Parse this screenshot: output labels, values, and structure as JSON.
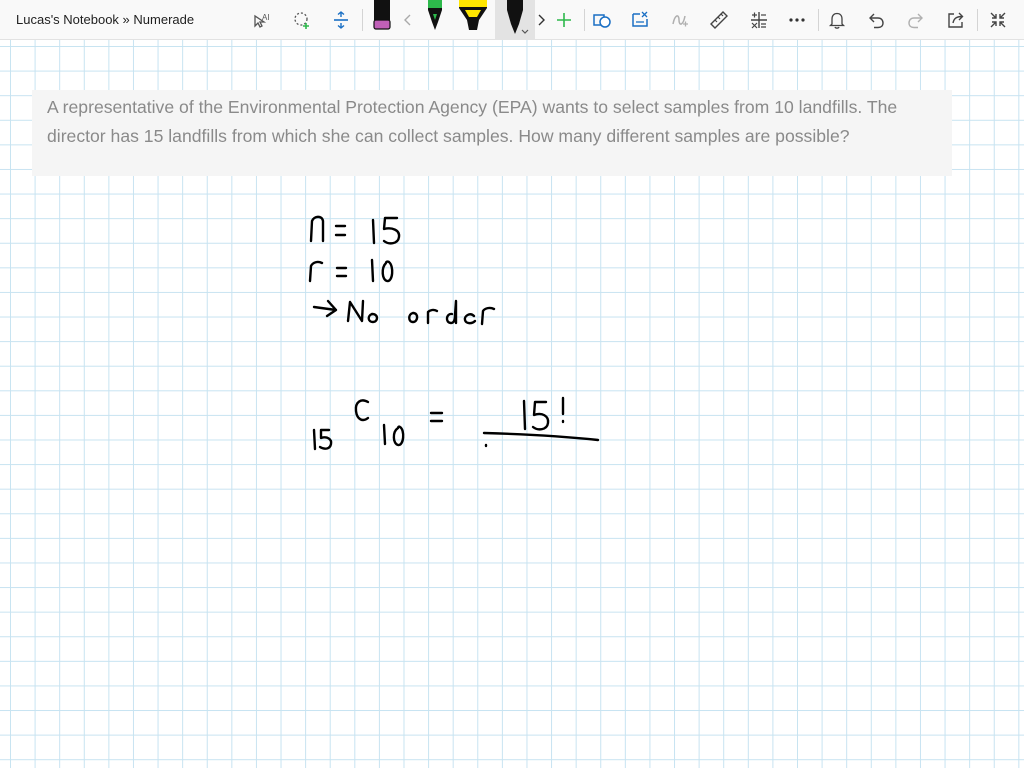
{
  "window": {
    "title": "Lucas's Notebook » Numerade"
  },
  "toolbar": {
    "tools": [
      {
        "name": "select-text-tool",
        "icon": "text-select-icon"
      },
      {
        "name": "lasso-select-tool",
        "icon": "lasso-add-icon"
      },
      {
        "name": "add-space-tool",
        "icon": "add-space-icon"
      },
      {
        "name": "eraser-tool",
        "icon": "eraser-icon",
        "color": "#c060b8"
      },
      {
        "name": "scroll-pens-left",
        "icon": "chevron-left-icon"
      },
      {
        "name": "pen-green",
        "icon": "pen-icon",
        "color": "#2db84b"
      },
      {
        "name": "highlighter-yellow",
        "icon": "highlighter-icon",
        "color": "#ffe600"
      },
      {
        "name": "pen-black",
        "icon": "pen-icon",
        "color": "#111111"
      },
      {
        "name": "scroll-pens-right",
        "icon": "chevron-right-icon"
      },
      {
        "name": "add-pen",
        "icon": "plus-icon",
        "color": "#2db84b"
      },
      {
        "name": "ink-to-shape",
        "icon": "shape-icon"
      },
      {
        "name": "ink-to-text",
        "icon": "ink-to-text-icon"
      },
      {
        "name": "ink-to-math",
        "icon": "ink-math-icon"
      },
      {
        "name": "ruler",
        "icon": "ruler-icon"
      },
      {
        "name": "math-tool",
        "icon": "math-icon"
      },
      {
        "name": "more",
        "icon": "more-icon"
      },
      {
        "name": "notifications",
        "icon": "bell-icon"
      },
      {
        "name": "undo",
        "icon": "undo-icon"
      },
      {
        "name": "redo",
        "icon": "redo-icon"
      },
      {
        "name": "share",
        "icon": "share-icon"
      },
      {
        "name": "exit-full-screen",
        "icon": "collapse-icon"
      }
    ]
  },
  "problem": {
    "text": "A representative of the Environmental Protection Agency (EPA) wants to select samples from 10 landfills. The director has 15 landfills from which she can collect samples. How many different samples are possible?"
  },
  "handwriting": {
    "line1": "n = 15",
    "line2": "r = 10",
    "line3": "→ No order",
    "formula": "15 C 10 = 15! / ..."
  },
  "colors": {
    "grid": "#c7e3f1",
    "ink": "#000000",
    "problem_bg": "#f5f5f5",
    "problem_text": "#8a8a8a"
  }
}
